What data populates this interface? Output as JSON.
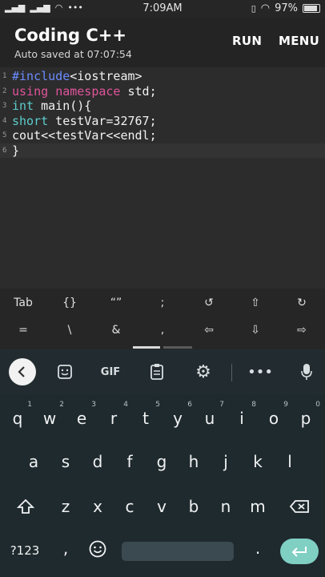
{
  "status": {
    "time": "7:09AM",
    "battery": "97%",
    "left_icons": [
      "signal-icon",
      "signal-icon",
      "wifi-icon",
      "more-dots-icon"
    ],
    "right_icons": [
      "screen-icon",
      "wifi-icon",
      "battery-icon"
    ]
  },
  "app_bar": {
    "title": "Coding C++",
    "subtitle": "Auto saved at 07:07:54",
    "run_label": "RUN",
    "menu_label": "MENU"
  },
  "editor": {
    "current_line": 6,
    "lines": [
      {
        "num": "1",
        "parts": [
          {
            "t": "#include",
            "c": "blue"
          },
          {
            "t": "<iostream>",
            "c": "plain"
          }
        ]
      },
      {
        "num": "2",
        "parts": [
          {
            "t": "using",
            "c": "pink"
          },
          {
            "t": " ",
            "c": "plain"
          },
          {
            "t": "namespace",
            "c": "pink"
          },
          {
            "t": " std;",
            "c": "plain"
          }
        ]
      },
      {
        "num": "3",
        "parts": [
          {
            "t": "int",
            "c": "teal"
          },
          {
            "t": " main(){",
            "c": "plain"
          }
        ]
      },
      {
        "num": "4",
        "parts": [
          {
            "t": "short",
            "c": "teal"
          },
          {
            "t": " testVar=32767;",
            "c": "plain"
          }
        ]
      },
      {
        "num": "5",
        "parts": [
          {
            "t": "cout<<testVar<<endl;",
            "c": "plain"
          }
        ]
      },
      {
        "num": "6",
        "parts": [
          {
            "t": "}",
            "c": "plain"
          }
        ]
      }
    ]
  },
  "symbols": {
    "row1": [
      "Tab",
      "{}",
      "“”",
      ";",
      "↺",
      "⇧",
      "↻"
    ],
    "row2": [
      "=",
      "\\",
      "&",
      ",",
      "⇦",
      "⇩",
      "⇨"
    ]
  },
  "keyboard": {
    "toolbar": {
      "gif_label": "GIF",
      "icons": [
        "back-chevron-icon",
        "sticker-icon",
        "gif-icon",
        "clipboard-icon",
        "gear-icon",
        "more-icon",
        "microphone-icon"
      ]
    },
    "row1": [
      {
        "k": "q",
        "n": "1"
      },
      {
        "k": "w",
        "n": "2"
      },
      {
        "k": "e",
        "n": "3"
      },
      {
        "k": "r",
        "n": "4"
      },
      {
        "k": "t",
        "n": "5"
      },
      {
        "k": "y",
        "n": "6"
      },
      {
        "k": "u",
        "n": "7"
      },
      {
        "k": "i",
        "n": "8"
      },
      {
        "k": "o",
        "n": "9"
      },
      {
        "k": "p",
        "n": "0"
      }
    ],
    "row2": [
      "a",
      "s",
      "d",
      "f",
      "g",
      "h",
      "j",
      "k",
      "l"
    ],
    "row3": [
      "z",
      "x",
      "c",
      "v",
      "b",
      "n",
      "m"
    ],
    "bottom": {
      "numbers_label": "?123",
      "comma": ",",
      "period": "."
    }
  }
}
